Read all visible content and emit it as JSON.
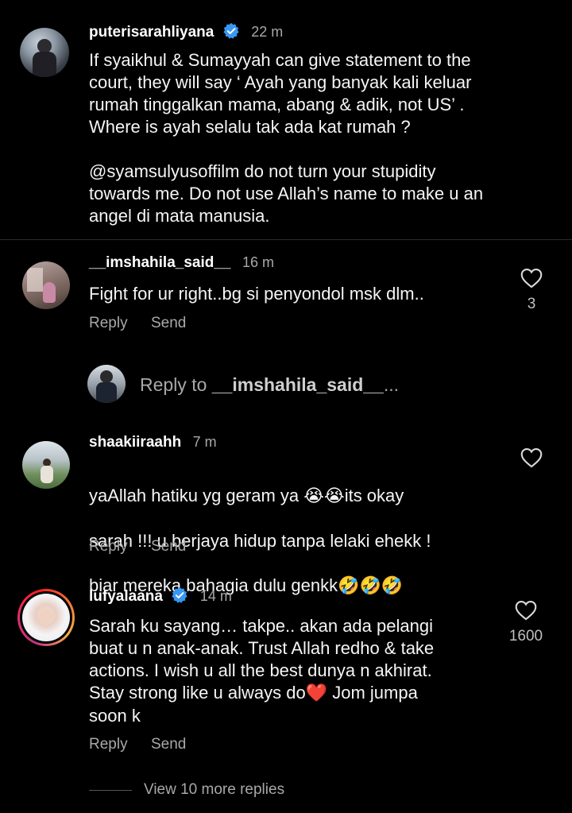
{
  "comments": [
    {
      "username": "puterisarahliyana",
      "time": "22 m",
      "paragraph1": "If syaikhul & Sumayyah can give statement to the\ncourt, they will say ‘ Ayah yang banyak kali keluar\nrumah tinggalkan mama, abang & adik, not US’ .\nWhere is ayah selalu tak ada kat rumah ?",
      "paragraph2": "@syamsulyusoffilm do not turn your stupidity\ntowards me. Do not use Allah’s name to make u an\nangel di mata manusia."
    },
    {
      "username": "__imshahila_said__",
      "time": "16 m",
      "text": "Fight for ur right..bg si penyondol msk dlm..",
      "likes": "3",
      "reply": "Reply",
      "send": "Send"
    },
    {
      "username": "shaakiiraahh",
      "time": "7 m",
      "line1": "yaAllah hatiku yg geram ya",
      "line1_emoji": "😭😭",
      "line1_after": "its okay",
      "line2": "sarah !!! u berjaya hidup tanpa lelaki ehekk !",
      "line3": "biar mereka bahagia dulu genkk",
      "line3_emoji": "🤣🤣🤣",
      "reply": "Reply",
      "send": "Send"
    },
    {
      "username": "lufyalaana",
      "time": "14 m",
      "text_main": "Sarah ku sayang… takpe.. akan ada pelangi\nbuat u n anak-anak. Trust Allah redho & take\nactions. I wish u all the best dunya n akhirat.\nStay strong like u always do",
      "heart_emoji": "❤️",
      "text_after": " Jom jumpa\nsoon k",
      "likes": "1600",
      "reply": "Reply",
      "send": "Send"
    }
  ],
  "reply_box": {
    "prefix": "Reply to ",
    "target": "__imshahila_said__",
    "ellipsis": "..."
  },
  "view_more": "View 10 more replies",
  "colors": {
    "background": "#000000",
    "verified": "#3897f0",
    "secondary_text": "#a8a8a8"
  }
}
